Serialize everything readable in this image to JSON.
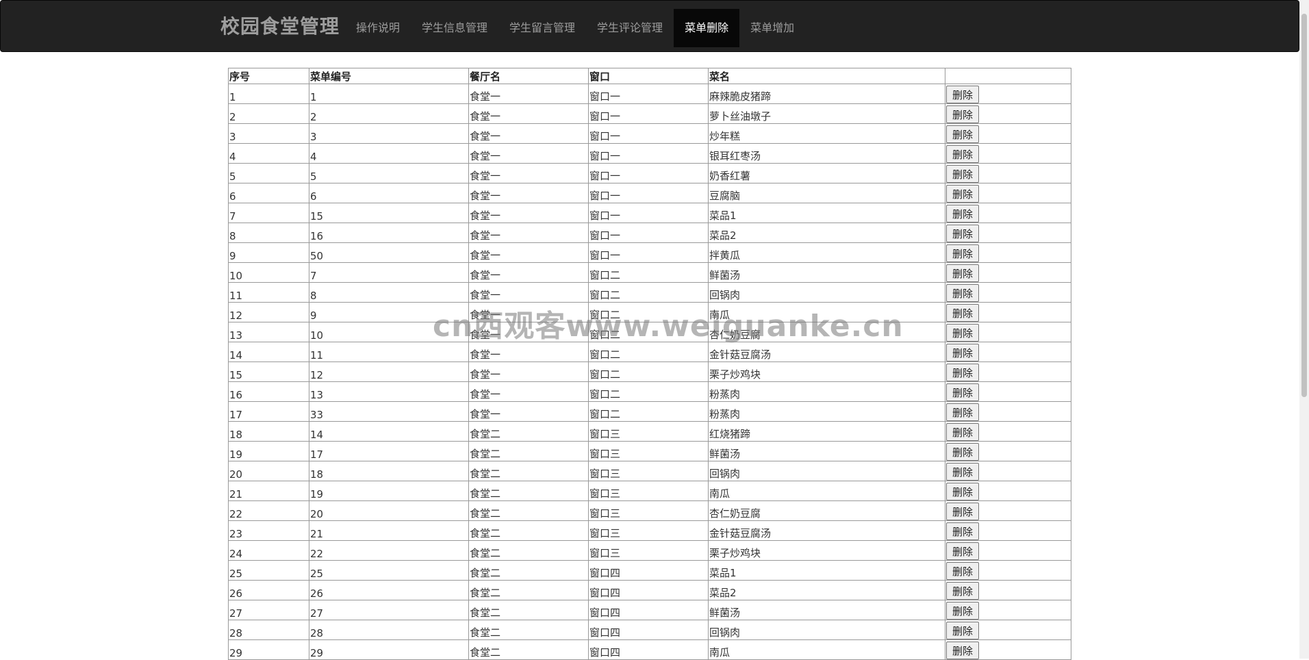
{
  "navbar": {
    "brand": "校园食堂管理",
    "items": [
      {
        "label": "操作说明",
        "active": false
      },
      {
        "label": "学生信息管理",
        "active": false
      },
      {
        "label": "学生留言管理",
        "active": false
      },
      {
        "label": "学生评论管理",
        "active": false
      },
      {
        "label": "菜单删除",
        "active": true
      },
      {
        "label": "菜单增加",
        "active": false
      }
    ]
  },
  "table": {
    "headers": [
      "序号",
      "菜单编号",
      "餐厅名",
      "窗口",
      "菜名",
      ""
    ],
    "delete_label": "删除",
    "rows": [
      [
        "1",
        "1",
        "食堂一",
        "窗口一",
        "麻辣脆皮猪蹄"
      ],
      [
        "2",
        "2",
        "食堂一",
        "窗口一",
        "萝卜丝油墩子"
      ],
      [
        "3",
        "3",
        "食堂一",
        "窗口一",
        "炒年糕"
      ],
      [
        "4",
        "4",
        "食堂一",
        "窗口一",
        "银耳红枣汤"
      ],
      [
        "5",
        "5",
        "食堂一",
        "窗口一",
        "奶香红薯"
      ],
      [
        "6",
        "6",
        "食堂一",
        "窗口一",
        "豆腐脑"
      ],
      [
        "7",
        "15",
        "食堂一",
        "窗口一",
        "菜品1"
      ],
      [
        "8",
        "16",
        "食堂一",
        "窗口一",
        "菜品2"
      ],
      [
        "9",
        "50",
        "食堂一",
        "窗口一",
        "拌黄瓜"
      ],
      [
        "10",
        "7",
        "食堂一",
        "窗口二",
        "鲜菌汤"
      ],
      [
        "11",
        "8",
        "食堂一",
        "窗口二",
        "回锅肉"
      ],
      [
        "12",
        "9",
        "食堂一",
        "窗口二",
        "南瓜"
      ],
      [
        "13",
        "10",
        "食堂一",
        "窗口二",
        "杏仁奶豆腐"
      ],
      [
        "14",
        "11",
        "食堂一",
        "窗口二",
        "金针菇豆腐汤"
      ],
      [
        "15",
        "12",
        "食堂一",
        "窗口二",
        "栗子炒鸡块"
      ],
      [
        "16",
        "13",
        "食堂一",
        "窗口二",
        "粉蒸肉"
      ],
      [
        "17",
        "33",
        "食堂一",
        "窗口二",
        "粉蒸肉"
      ],
      [
        "18",
        "14",
        "食堂二",
        "窗口三",
        "红烧猪蹄"
      ],
      [
        "19",
        "17",
        "食堂二",
        "窗口三",
        "鲜菌汤"
      ],
      [
        "20",
        "18",
        "食堂二",
        "窗口三",
        "回锅肉"
      ],
      [
        "21",
        "19",
        "食堂二",
        "窗口三",
        "南瓜"
      ],
      [
        "22",
        "20",
        "食堂二",
        "窗口三",
        "杏仁奶豆腐"
      ],
      [
        "23",
        "21",
        "食堂二",
        "窗口三",
        "金针菇豆腐汤"
      ],
      [
        "24",
        "22",
        "食堂二",
        "窗口三",
        "栗子炒鸡块"
      ],
      [
        "25",
        "25",
        "食堂二",
        "窗口四",
        "菜品1"
      ],
      [
        "26",
        "26",
        "食堂二",
        "窗口四",
        "菜品2"
      ],
      [
        "27",
        "27",
        "食堂二",
        "窗口四",
        "鲜菌汤"
      ],
      [
        "28",
        "28",
        "食堂二",
        "窗口四",
        "回锅肉"
      ],
      [
        "29",
        "29",
        "食堂二",
        "窗口四",
        "南瓜"
      ]
    ]
  },
  "watermark": "cn西观客www.weiguanke.cn"
}
